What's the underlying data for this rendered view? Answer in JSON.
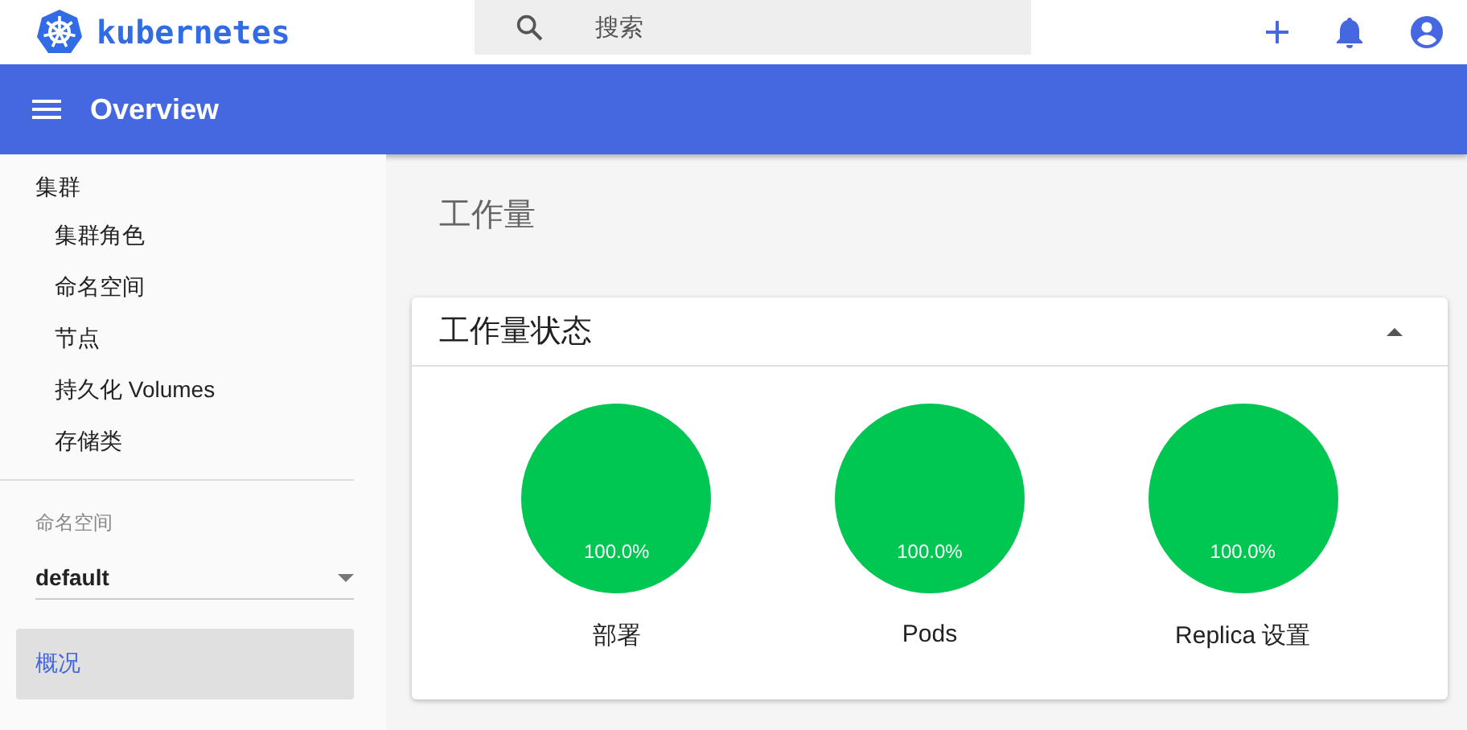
{
  "brand": {
    "name": "kubernetes"
  },
  "search": {
    "placeholder": "搜索"
  },
  "toolbar": {
    "title": "Overview"
  },
  "sidebar": {
    "section": {
      "label": "集群",
      "children": [
        {
          "label": "集群角色"
        },
        {
          "label": "命名空间"
        },
        {
          "label": "节点"
        },
        {
          "label": "持久化 Volumes"
        },
        {
          "label": "存储类"
        }
      ]
    },
    "namespace": {
      "label": "命名空间",
      "value": "default"
    },
    "nav": [
      {
        "label": "概况",
        "selected": true
      }
    ]
  },
  "page_title": "工作量",
  "card": {
    "title": "工作量状态",
    "expanded": true,
    "charts": [
      {
        "label": "部署",
        "reading": "100.0%",
        "level": 1
      },
      {
        "label": "Pods",
        "reading": "100.0%",
        "level": 1
      },
      {
        "label": "Replica 设置",
        "reading": "100.0%",
        "level": 1
      }
    ]
  }
}
